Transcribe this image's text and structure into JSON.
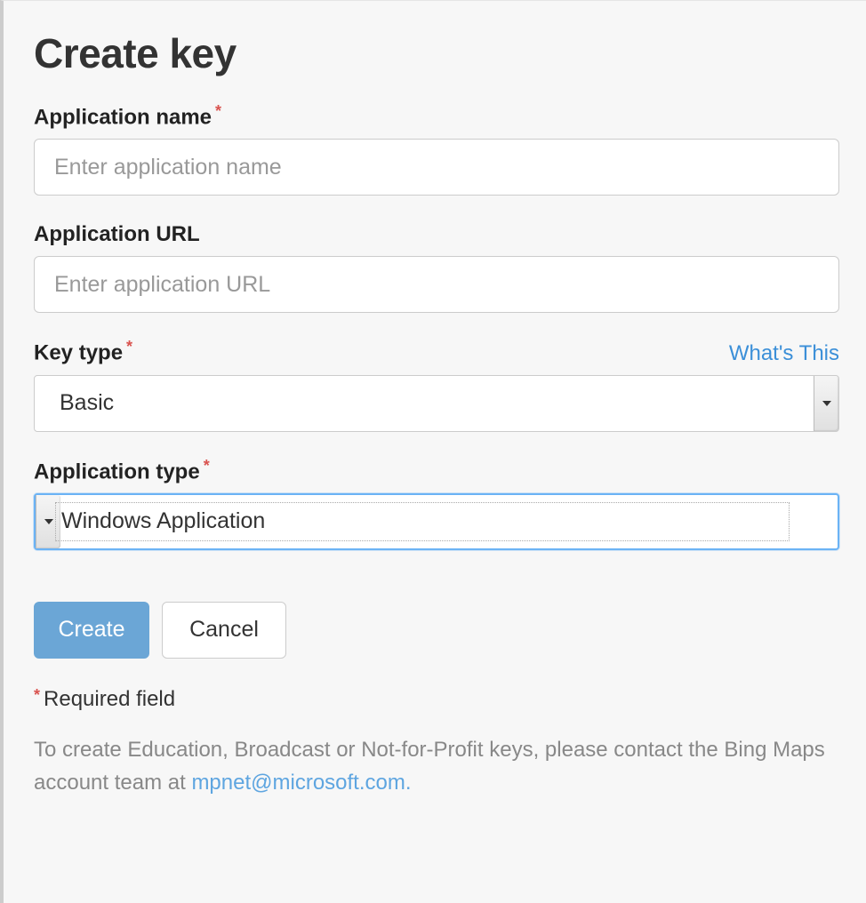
{
  "page": {
    "title": "Create key"
  },
  "form": {
    "app_name": {
      "label": "Application name",
      "required": true,
      "placeholder": "Enter application name",
      "value": ""
    },
    "app_url": {
      "label": "Application URL",
      "required": false,
      "placeholder": "Enter application URL",
      "value": ""
    },
    "key_type": {
      "label": "Key type",
      "required": true,
      "help_link": "What's This",
      "selected": "Basic"
    },
    "app_type": {
      "label": "Application type",
      "required": true,
      "selected": "Windows Application"
    }
  },
  "buttons": {
    "create": "Create",
    "cancel": "Cancel"
  },
  "notes": {
    "required_field": "Required field",
    "footer_prefix": "To create Education, Broadcast or Not-for-Profit keys, please contact the Bing Maps account team at ",
    "footer_email": "mpnet@microsoft.com",
    "footer_suffix": "."
  },
  "required_marker": "*"
}
